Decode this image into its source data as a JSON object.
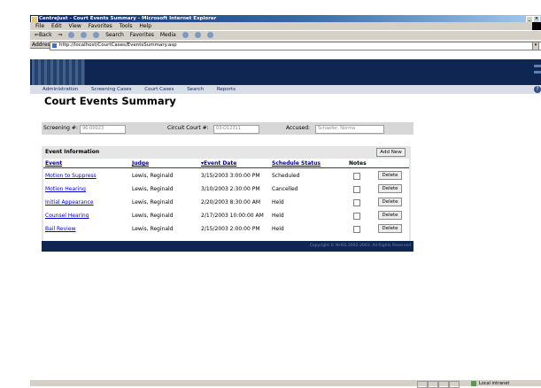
{
  "window": {
    "title": "CentreJust - Court Events Summary - Microsoft Internet Explorer",
    "minimize": "_",
    "close": "×"
  },
  "menu": [
    "File",
    "Edit",
    "View",
    "Favorites",
    "Tools",
    "Help"
  ],
  "toolbar": {
    "back": "⇐Back",
    "forward": "⇒",
    "search": "Search",
    "favorites": "Favorites",
    "media": "Media"
  },
  "address": {
    "label": "Address",
    "url": "http://localhost/CourtCases/EventsSummary.asp"
  },
  "nav": [
    "Administration",
    "Screening Cases",
    "Court Cases",
    "Search",
    "Reports"
  ],
  "nav_help": "?",
  "page": {
    "title": "Court Events Summary"
  },
  "filters": {
    "screening_label": "Screening #:",
    "screening_value": "96-00023",
    "circuit_label": "Circuit Court #:",
    "circuit_value": "03-D12311",
    "accused_label": "Accused:",
    "accused_value": "Schaefer, Norma"
  },
  "events": {
    "header": "Event Information",
    "add_label": "Add New",
    "columns": {
      "event": "Event",
      "judge": "Judge",
      "date": "▾Event Date",
      "status": "Schedule Status",
      "notes": "Notes"
    },
    "delete_label": "Delete",
    "rows": [
      {
        "event": "Motion to Suppress",
        "judge": "Lewis, Reginald",
        "date": "3/15/2003 3:00:00 PM",
        "status": "Scheduled"
      },
      {
        "event": "Motion Hearing",
        "judge": "Lewis, Reginald",
        "date": "3/10/2003 2:30:00 PM",
        "status": "Cancelled"
      },
      {
        "event": "Initial Appearance",
        "judge": "Lewis, Reginald",
        "date": "2/20/2003 8:30:00 AM",
        "status": "Held"
      },
      {
        "event": "Counsel Hearing",
        "judge": "Lewis, Reginald",
        "date": "2/17/2003 10:00:00 AM",
        "status": "Held"
      },
      {
        "event": "Bail Review",
        "judge": "Lewis, Reginald",
        "date": "2/15/2003 2:00:00 PM",
        "status": "Held"
      }
    ]
  },
  "footer": "Copyright © NHSS 2002-2003. All Rights Reserved",
  "status": {
    "zone": "Local intranet"
  }
}
